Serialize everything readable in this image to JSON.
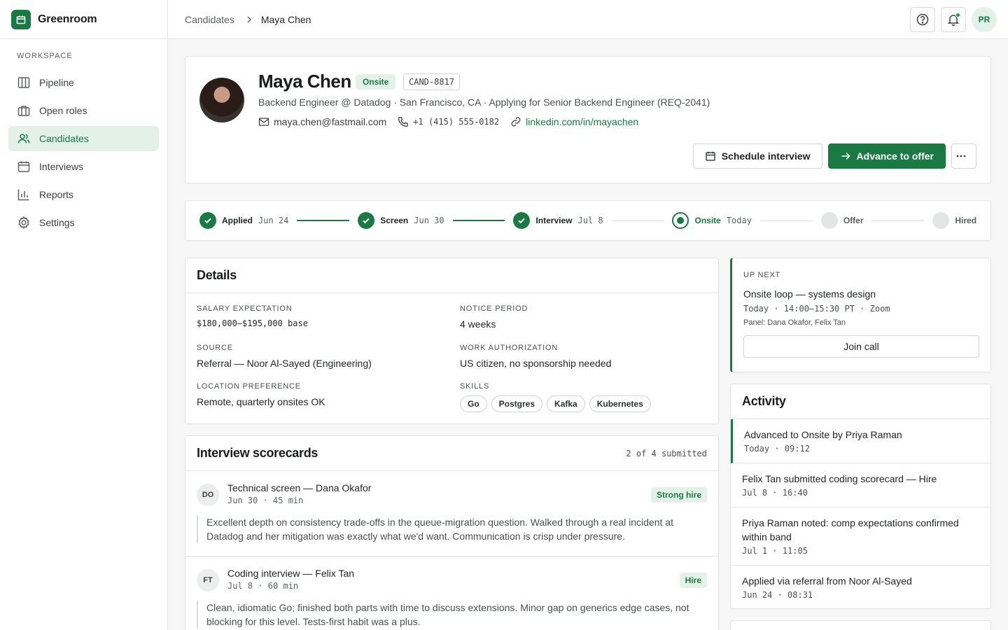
{
  "app": {
    "name": "Greenroom"
  },
  "colors": {
    "accent": "#1b7a44",
    "accent_bg": "#e3f1e8"
  },
  "sidebar": {
    "heading": "WORKSPACE",
    "items": [
      {
        "label": "Pipeline",
        "icon": "columns-icon"
      },
      {
        "label": "Open roles",
        "icon": "briefcase-icon"
      },
      {
        "label": "Candidates",
        "icon": "users-icon",
        "active": true
      },
      {
        "label": "Interviews",
        "icon": "calendar-icon"
      },
      {
        "label": "Reports",
        "icon": "bar-chart-icon"
      },
      {
        "label": "Settings",
        "icon": "gear-icon"
      }
    ]
  },
  "breadcrumb": {
    "parent": "Candidates",
    "current": "Maya Chen"
  },
  "user": {
    "initials": "PR"
  },
  "candidate": {
    "name": "Maya Chen",
    "stage": "Onsite",
    "id": "CAND-8817",
    "subtitle": "Backend Engineer @ Datadog · San Francisco, CA · Applying for Senior Backend Engineer (REQ-2041)",
    "email": "maya.chen@fastmail.com",
    "phone": "+1 (415) 555-0182",
    "linkedin": "linkedin.com/in/mayachen"
  },
  "actions": {
    "schedule": "Schedule interview",
    "advance": "Advance to offer"
  },
  "stages": [
    {
      "label": "Applied",
      "date": "Jun 24",
      "state": "done"
    },
    {
      "label": "Screen",
      "date": "Jun 30",
      "state": "done"
    },
    {
      "label": "Interview",
      "date": "Jul 8",
      "state": "done"
    },
    {
      "label": "Onsite",
      "date": "Today",
      "state": "current"
    },
    {
      "label": "Offer",
      "date": "",
      "state": "future"
    },
    {
      "label": "Hired",
      "date": "",
      "state": "future"
    }
  ],
  "details": {
    "title": "Details",
    "salary": {
      "label": "SALARY EXPECTATION",
      "value": "$180,000–$195,000 base"
    },
    "notice": {
      "label": "NOTICE PERIOD",
      "value": "4 weeks"
    },
    "source": {
      "label": "SOURCE",
      "value": "Referral — Noor Al-Sayed (Engineering)"
    },
    "work_auth": {
      "label": "WORK AUTHORIZATION",
      "value": "US citizen, no sponsorship needed"
    },
    "location": {
      "label": "LOCATION PREFERENCE",
      "value": "Remote, quarterly onsites OK"
    },
    "skills": {
      "label": "SKILLS",
      "items": [
        "Go",
        "Postgres",
        "Kafka",
        "Kubernetes"
      ]
    }
  },
  "scorecards": {
    "title": "Interview scorecards",
    "count": "2 of 4 submitted",
    "items": [
      {
        "initials": "DO",
        "title": "Technical screen — Dana Okafor",
        "meta": "Jun 30 · 45 min",
        "verdict": "Strong hire",
        "note": "Excellent depth on consistency trade-offs in the queue-migration question. Walked through a real incident at Datadog and her mitigation was exactly what we'd want. Communication is crisp under pressure."
      },
      {
        "initials": "FT",
        "title": "Coding interview — Felix Tan",
        "meta": "Jul 8 · 60 min",
        "verdict": "Hire",
        "note": "Clean, idiomatic Go; finished both parts with time to discuss extensions. Minor gap on generics edge cases, not blocking for this level. Tests-first habit was a plus."
      }
    ]
  },
  "up_next": {
    "label": "UP NEXT",
    "title": "Onsite loop — systems design",
    "time": "Today · 14:00–15:30 PT · Zoom",
    "panel": "Panel: Dana Okafor, Felix Tan",
    "button": "Join call"
  },
  "activity": {
    "title": "Activity",
    "items": [
      {
        "text": "Advanced to Onsite by Priya Raman",
        "time": "Today · 09:12"
      },
      {
        "text": "Felix Tan submitted coding scorecard — Hire",
        "time": "Jul 8 · 16:40"
      },
      {
        "text": "Priya Raman noted: comp expectations confirmed within band",
        "time": "Jul 1 · 11:05"
      },
      {
        "text": "Applied via referral from Noor Al-Sayed",
        "time": "Jun 24 · 08:31"
      }
    ]
  }
}
